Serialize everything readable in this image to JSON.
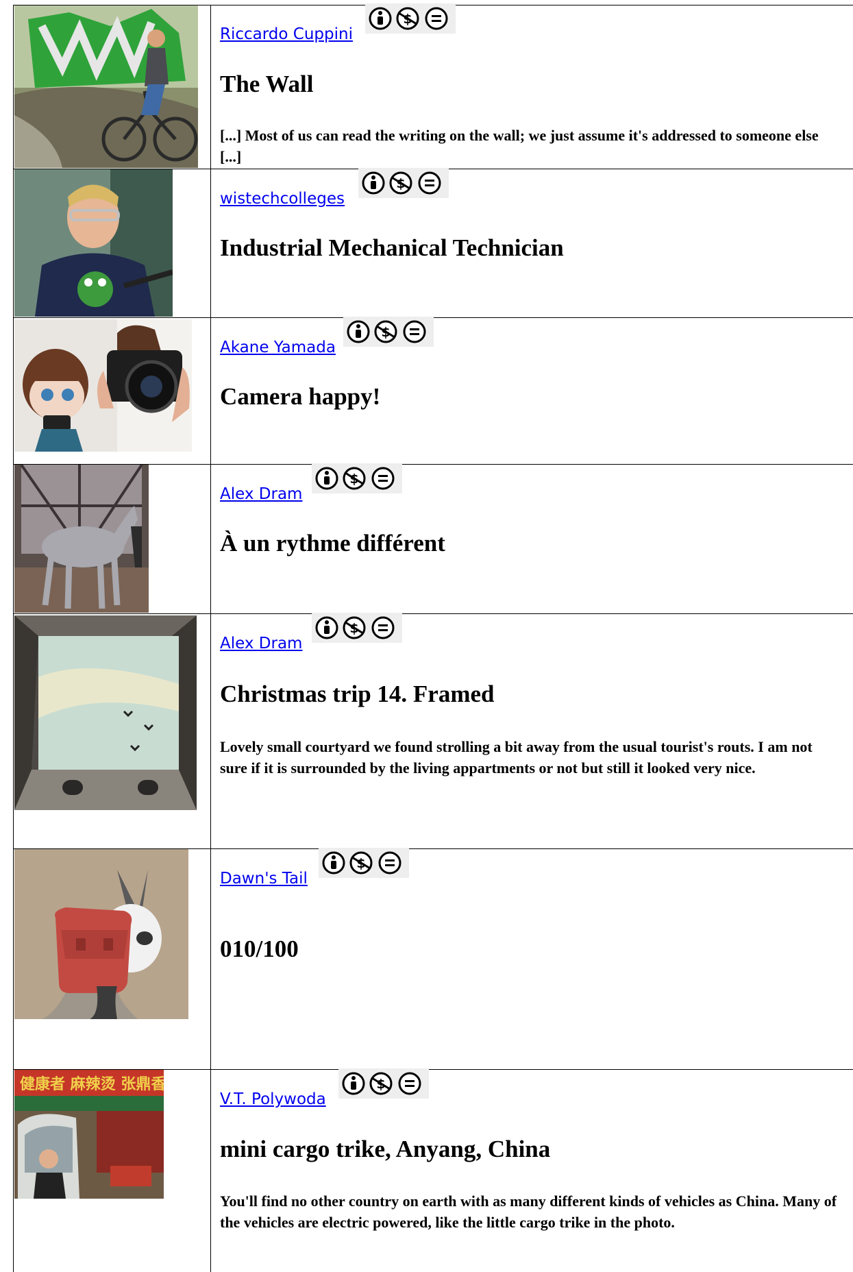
{
  "entries": [
    {
      "author": "Riccardo Cuppini",
      "license_icons": [
        "cc-by-icon",
        "cc-nc-icon",
        "cc-nd-icon"
      ],
      "title": "The Wall",
      "description": "[...] Most of us can read the writing on the wall; we just assume it's addressed to someone else [...]"
    },
    {
      "author": "wistechcolleges",
      "license_icons": [
        "cc-by-icon",
        "cc-nc-icon",
        "cc-nd-icon"
      ],
      "title": "Industrial Mechanical Technician",
      "description": ""
    },
    {
      "author": "Akane Yamada",
      "license_icons": [
        "cc-by-icon",
        "cc-nc-icon",
        "cc-nd-icon"
      ],
      "title": "Camera happy!",
      "description": ""
    },
    {
      "author": "Alex Dram",
      "license_icons": [
        "cc-by-icon",
        "cc-nc-icon",
        "cc-nd-icon"
      ],
      "title": "À un rythme différent",
      "description": ""
    },
    {
      "author": "Alex Dram",
      "license_icons": [
        "cc-by-icon",
        "cc-nc-icon",
        "cc-nd-icon"
      ],
      "title": "Christmas trip 14. Framed",
      "description": "Lovely small courtyard we found strolling a bit away from the usual tourist's routs. I am not sure if it is surrounded by the living appartments or not but still it looked very nice."
    },
    {
      "author": "Dawn's Tail",
      "license_icons": [
        "cc-by-icon",
        "cc-nc-icon",
        "cc-nd-icon"
      ],
      "title": "010/100",
      "description": ""
    },
    {
      "author": "V.T. Polywoda",
      "license_icons": [
        "cc-by-icon",
        "cc-nc-icon",
        "cc-nd-icon"
      ],
      "title": "mini cargo trike, Anyang, China",
      "description": "You'll find no other country on earth with as many different kinds of vehicles as China. Many of the vehicles are electric powered, like the little cargo trike in the photo."
    }
  ],
  "colors": {
    "link": "#0000ee",
    "badge_bg": "#eeeeee",
    "border": "#000000"
  }
}
